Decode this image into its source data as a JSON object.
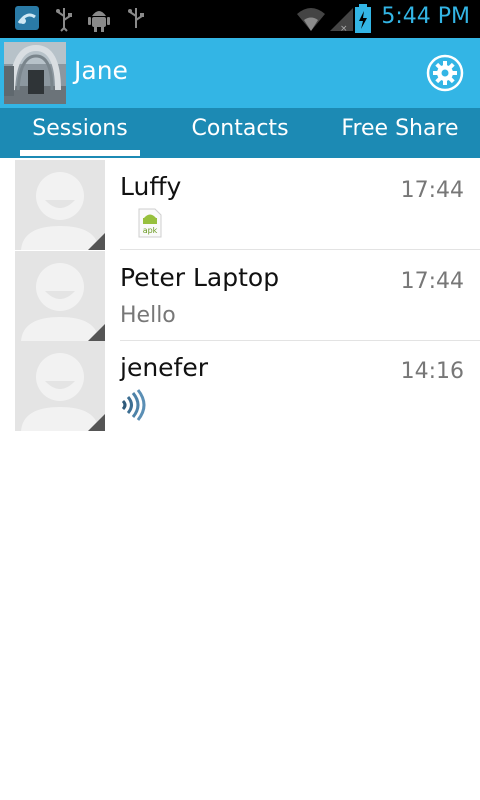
{
  "statusbar": {
    "time": "5:44 PM",
    "icons": [
      "app-notification-icon",
      "usb-icon",
      "android-debug-icon",
      "usb-icon",
      "wifi-icon",
      "signal-icon",
      "battery-charging-icon"
    ]
  },
  "appbar": {
    "user_name": "Jane",
    "settings_icon": "gear-icon"
  },
  "tabs": [
    {
      "label": "Sessions",
      "active": true
    },
    {
      "label": "Contacts",
      "active": false
    },
    {
      "label": "Free Share",
      "active": false
    }
  ],
  "sessions": [
    {
      "name": "Luffy",
      "time": "17:44",
      "preview": "",
      "preview_icon": "apk",
      "apk_label": "apk"
    },
    {
      "name": "Peter Laptop",
      "time": "17:44",
      "preview": "Hello",
      "preview_icon": ""
    },
    {
      "name": "jenefer",
      "time": "14:16",
      "preview": "",
      "preview_icon": "voice"
    }
  ],
  "colors": {
    "accent": "#33b5e5",
    "tabbar": "#1c8ab4",
    "statusbar": "#000000"
  }
}
